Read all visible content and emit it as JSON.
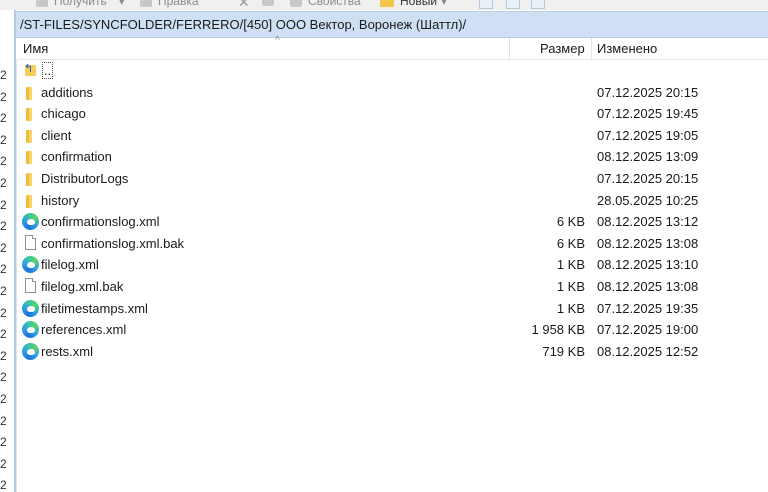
{
  "toolbar": {
    "receive_label": "Получить",
    "edit_label": "Правка",
    "properties_label": "Свойства",
    "new_label": "Новый"
  },
  "path": "/ST-FILES/SYNCFOLDER/FERRERO/[450] ООО Вектор, Воронеж (Шаттл)/",
  "columns": {
    "name": "Имя",
    "size": "Размер",
    "modified": "Изменено"
  },
  "left_pane_numbers": [
    "2",
    "2",
    "2",
    "2",
    "2",
    "2",
    "2",
    "2",
    "2",
    "2",
    "2",
    "2",
    "2",
    "2",
    "2",
    "2",
    "2",
    "2",
    "2",
    "2"
  ],
  "rows": [
    {
      "type": "up",
      "name": "..",
      "size": "",
      "modified": ""
    },
    {
      "type": "folder",
      "name": "additions",
      "size": "",
      "modified": "07.12.2025 20:15"
    },
    {
      "type": "folder",
      "name": "chicago",
      "size": "",
      "modified": "07.12.2025 19:45"
    },
    {
      "type": "folder",
      "name": "client",
      "size": "",
      "modified": "07.12.2025 19:05"
    },
    {
      "type": "folder",
      "name": "confirmation",
      "size": "",
      "modified": "08.12.2025 13:09"
    },
    {
      "type": "folder",
      "name": "DistributorLogs",
      "size": "",
      "modified": "07.12.2025 20:15"
    },
    {
      "type": "folder",
      "name": "history",
      "size": "",
      "modified": "28.05.2025 10:25"
    },
    {
      "type": "xml",
      "name": "confirmationslog.xml",
      "size": "6 KB",
      "modified": "08.12.2025 13:12"
    },
    {
      "type": "file",
      "name": "confirmationslog.xml.bak",
      "size": "6 KB",
      "modified": "08.12.2025 13:08"
    },
    {
      "type": "xml",
      "name": "filelog.xml",
      "size": "1 KB",
      "modified": "08.12.2025 13:10"
    },
    {
      "type": "file",
      "name": "filelog.xml.bak",
      "size": "1 KB",
      "modified": "08.12.2025 13:08"
    },
    {
      "type": "xml",
      "name": "filetimestamps.xml",
      "size": "1 KB",
      "modified": "07.12.2025 19:35"
    },
    {
      "type": "xml",
      "name": "references.xml",
      "size": "1 958 KB",
      "modified": "07.12.2025 19:00"
    },
    {
      "type": "xml",
      "name": "rests.xml",
      "size": "719 KB",
      "modified": "08.12.2025 12:52"
    }
  ],
  "colors": {
    "path_bar": "#cfe0f5",
    "folder": "#f2bd35"
  }
}
